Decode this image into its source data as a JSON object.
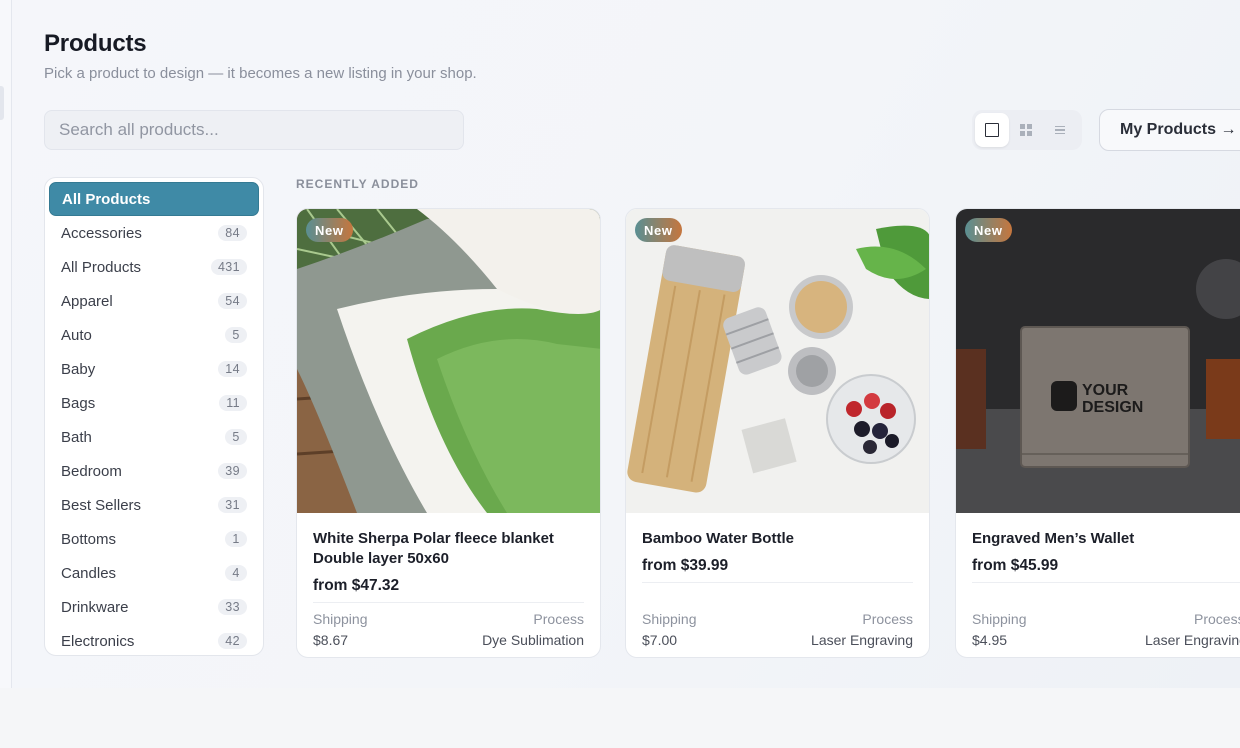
{
  "header": {
    "title": "Products",
    "subtitle": "Pick a product to design — it becomes a new listing in your shop."
  },
  "search": {
    "placeholder": "Search all products...",
    "value": ""
  },
  "view_toggle": {
    "options": [
      "single",
      "grid",
      "list"
    ],
    "active": "single"
  },
  "my_products_button": {
    "label": "My Products →"
  },
  "sidebar": {
    "items": [
      {
        "label": "All Products",
        "count": "",
        "active": true
      },
      {
        "label": "Accessories",
        "count": "84"
      },
      {
        "label": "All Products",
        "count": "431"
      },
      {
        "label": "Apparel",
        "count": "54"
      },
      {
        "label": "Auto",
        "count": "5"
      },
      {
        "label": "Baby",
        "count": "14"
      },
      {
        "label": "Bags",
        "count": "11"
      },
      {
        "label": "Bath",
        "count": "5"
      },
      {
        "label": "Bedroom",
        "count": "39"
      },
      {
        "label": "Best Sellers",
        "count": "31"
      },
      {
        "label": "Bottoms",
        "count": "1"
      },
      {
        "label": "Candles",
        "count": "4"
      },
      {
        "label": "Drinkware",
        "count": "33"
      },
      {
        "label": "Electronics",
        "count": "42"
      }
    ]
  },
  "section": {
    "label": "RECENTLY ADDED"
  },
  "products": [
    {
      "badge": "New",
      "title": "White Sherpa Polar fleece blanket Double layer 50x60",
      "price": "from $47.32",
      "shipping_label": "Shipping",
      "shipping_value": "$8.67",
      "process_label": "Process",
      "process_value": "Dye Sublimation",
      "image_icon": "blanket-photo"
    },
    {
      "badge": "New",
      "title": "Bamboo Water Bottle",
      "price": "from $39.99",
      "shipping_label": "Shipping",
      "shipping_value": "$7.00",
      "process_label": "Process",
      "process_value": "Laser Engraving",
      "image_icon": "bottle-photo"
    },
    {
      "badge": "New",
      "title": "Engraved Men’s Wallet",
      "price": "from $45.99",
      "shipping_label": "Shipping",
      "shipping_value": "$4.95",
      "process_label": "Process",
      "process_value": "Laser Engraving",
      "image_icon": "wallet-photo",
      "image_text": [
        "YOUR",
        "DESIGN"
      ]
    }
  ],
  "colors": {
    "accent": "#3f8aa6",
    "badge_from": "#5a8f93",
    "badge_to": "#c5763e"
  }
}
